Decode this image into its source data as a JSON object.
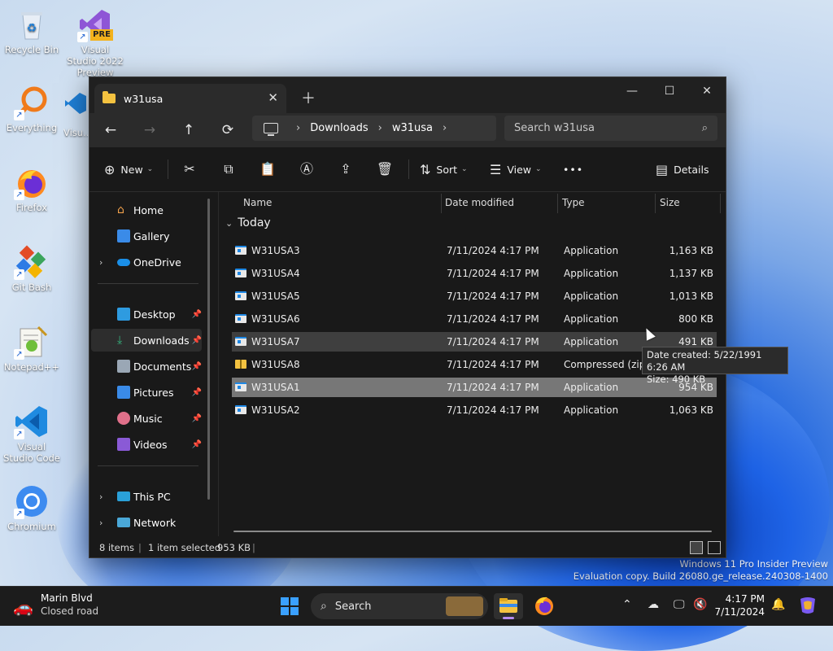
{
  "desktop": {
    "icons": [
      {
        "label": "Recycle Bin"
      },
      {
        "label": "Visual Studio 2022 Preview",
        "badge": "PRE"
      },
      {
        "label": "Everything"
      },
      {
        "label": "Visu..."
      },
      {
        "label": "Firefox"
      },
      {
        "label": "Git Bash"
      },
      {
        "label": "Notepad++"
      },
      {
        "label": "Visual Studio Code"
      },
      {
        "label": "Chromium"
      }
    ],
    "watermark_line1": "Windows 11 Pro Insider Preview",
    "watermark_line2": "Evaluation copy. Build 26080.ge_release.240308-1400"
  },
  "window": {
    "tab_title": "w31usa",
    "controls": {
      "minimize": "—",
      "maximize": "☐",
      "close": "✕"
    },
    "nav": {
      "back": "←",
      "forward": "→",
      "up": "↑",
      "refresh": "⟳"
    },
    "breadcrumb": [
      "Downloads",
      "w31usa"
    ],
    "search_placeholder": "Search w31usa",
    "toolbar": {
      "new_label": "New",
      "sort_label": "Sort",
      "view_label": "View",
      "more_label": "•••",
      "details_label": "Details"
    },
    "sidebar": {
      "home": "Home",
      "gallery": "Gallery",
      "onedrive": "OneDrive",
      "desktop": "Desktop",
      "downloads": "Downloads",
      "documents": "Documents",
      "pictures": "Pictures",
      "music": "Music",
      "videos": "Videos",
      "thispc": "This PC",
      "network": "Network"
    },
    "columns": {
      "name": "Name",
      "date": "Date modified",
      "type": "Type",
      "size": "Size"
    },
    "group": "Today",
    "files": [
      {
        "name": "W31USA3",
        "date": "7/11/2024 4:17 PM",
        "type": "Application",
        "size": "1,163 KB"
      },
      {
        "name": "W31USA4",
        "date": "7/11/2024 4:17 PM",
        "type": "Application",
        "size": "1,137 KB"
      },
      {
        "name": "W31USA5",
        "date": "7/11/2024 4:17 PM",
        "type": "Application",
        "size": "1,013 KB"
      },
      {
        "name": "W31USA6",
        "date": "7/11/2024 4:17 PM",
        "type": "Application",
        "size": "800 KB"
      },
      {
        "name": "W31USA7",
        "date": "7/11/2024 4:17 PM",
        "type": "Application",
        "size": "491 KB"
      },
      {
        "name": "W31USA8",
        "date": "7/11/2024 4:17 PM",
        "type": "Compressed (zipp...",
        "size": ""
      },
      {
        "name": "W31USA1",
        "date": "7/11/2024 4:17 PM",
        "type": "Application",
        "size": "954 KB"
      },
      {
        "name": "W31USA2",
        "date": "7/11/2024 4:17 PM",
        "type": "Application",
        "size": "1,063 KB"
      }
    ],
    "status": {
      "items": "8 items",
      "selected": "1 item selected",
      "selected_size": "953 KB"
    },
    "tooltip": {
      "line1": "Date created: 5/22/1991 6:26 AM",
      "line2": "Size: 490 KB"
    }
  },
  "taskbar": {
    "weather_title": "Marin Blvd",
    "weather_sub": "Closed road",
    "search_label": "Search",
    "time": "4:17 PM",
    "date": "7/11/2024"
  }
}
